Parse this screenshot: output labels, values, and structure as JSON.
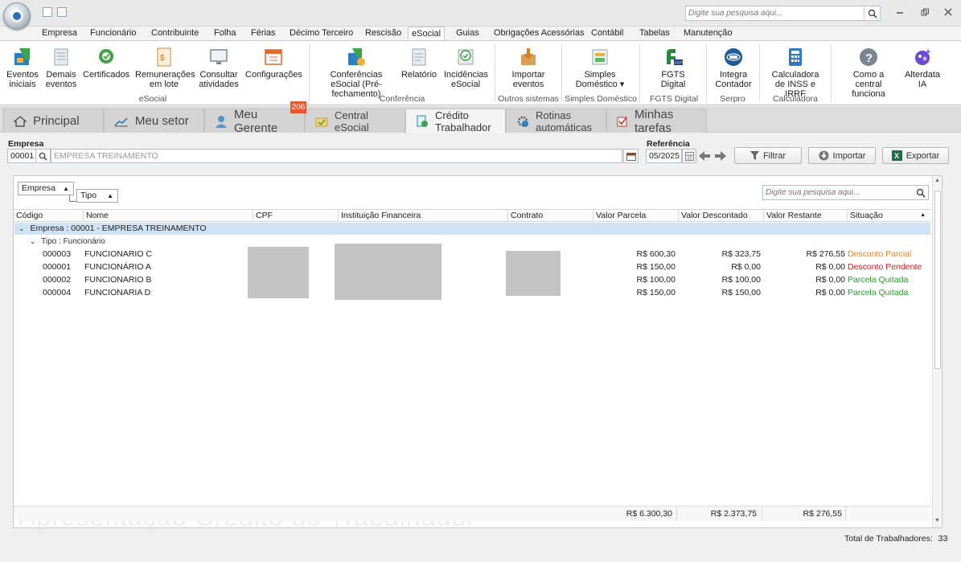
{
  "titlebar": {
    "search_placeholder": "Digite sua pesquisa aqui..."
  },
  "ribbon_tabs": [
    "Empresa",
    "Funcionário",
    "Contribuinte",
    "Folha",
    "Férias",
    "Décimo Terceiro",
    "Rescisão",
    "eSocial",
    "Guias",
    "Obrigações Acessórias",
    "Contábil",
    "Tabelas",
    "Manutenção"
  ],
  "ribbon": {
    "eventos_iniciais": "Eventos iniciais",
    "demais_eventos": "Demais eventos",
    "certificados": "Certificados",
    "remuneracoes": "Remunerações em lote",
    "consultar": "Consultar atividades",
    "configuracoes": "Configurações",
    "conferencias": "Conferências eSocial (Pré-fechamento)",
    "relatorio": "Relatório",
    "incidencias": "Incidências eSocial",
    "importar": "Importar eventos",
    "simples": "Simples Doméstico ▾",
    "fgts": "FGTS Digital",
    "integra": "Integra Contador",
    "calculadora": "Calculadora de INSS e IRRF",
    "como": "Como a central funciona",
    "alterdata": "Alterdata IA",
    "groups": {
      "esocial": "eSocial",
      "conferencia": "Conferência",
      "outros": "Outros sistemas",
      "simples": "Simples Doméstico",
      "fgts": "FGTS Digital",
      "serpro": "Serpro",
      "calculadora": "Calculadora"
    }
  },
  "main_tabs": {
    "principal": "Principal",
    "meu_setor": "Meu setor",
    "meu_gerente": "Meu Gerente",
    "central": "Central eSocial",
    "credito": "Crédito Trabalhador",
    "rotinas": "Rotinas automáticas",
    "tarefas": "Minhas tarefas",
    "badge": "206"
  },
  "filters": {
    "empresa_label": "Empresa",
    "empresa_code": "00001",
    "empresa_name": "EMPRESA TREINAMENTO",
    "referencia_label": "Referência",
    "referencia_value": "05/2025",
    "filtrar": "Filtrar",
    "importar": "Importar",
    "exportar": "Exportar"
  },
  "grid": {
    "group_chip_1": "Empresa",
    "group_chip_2": "Tipo",
    "search_placeholder": "Digite sua pesquisa aqui...",
    "columns": [
      "Código",
      "Nome",
      "CPF",
      "Instituição Financeira",
      "Contrato",
      "Valor Parcela",
      "Valor Descontado",
      "Valor Restante",
      "Situação"
    ],
    "group_row": "Empresa : 00001 - EMPRESA TREINAMENTO",
    "subgroup_row": "Tipo : Funcionário",
    "rows": [
      {
        "codigo": "000003",
        "nome": "FUNCIONARIO C",
        "parcela": "R$ 600,30",
        "descontado": "R$ 323,75",
        "restante": "R$ 276,55",
        "situacao": "Desconto Parcial",
        "color": "#e0892b"
      },
      {
        "codigo": "000001",
        "nome": "FUNCIONÁRIO A",
        "parcela": "R$ 150,00",
        "descontado": "R$ 0,00",
        "restante": "R$ 0,00",
        "situacao": "Desconto Pendente",
        "color": "#d62020"
      },
      {
        "codigo": "000002",
        "nome": "FUNCIONARIO B",
        "parcela": "R$ 100,00",
        "descontado": "R$ 100,00",
        "restante": "R$ 0,00",
        "situacao": "Parcela Quitada",
        "color": "#2e9a2e"
      },
      {
        "codigo": "000004",
        "nome": "FUNCIONARIA D",
        "parcela": "R$ 150,00",
        "descontado": "R$ 150,00",
        "restante": "R$ 0,00",
        "situacao": "Parcela Quitada",
        "color": "#2e9a2e"
      }
    ],
    "totals": {
      "parcela": "R$ 6.300,30",
      "descontado": "R$ 2.373,75",
      "restante": "R$ 276,55"
    },
    "watermark": "Apresentação  Crédito do Trabalhador"
  },
  "status": {
    "total_label": "Total de Trabalhadores:",
    "total_value": "33"
  }
}
